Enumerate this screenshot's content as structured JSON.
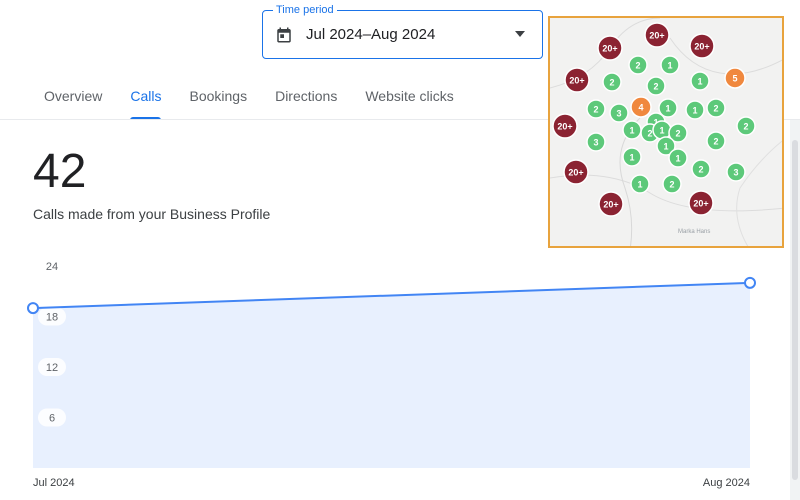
{
  "time_period": {
    "legend": "Time period",
    "value": "Jul 2024–Aug 2024",
    "icon": "calendar-icon",
    "dropdown_icon": "arrow-drop-down-icon"
  },
  "tabs": [
    {
      "label": "Overview",
      "active": false
    },
    {
      "label": "Calls",
      "active": true
    },
    {
      "label": "Bookings",
      "active": false
    },
    {
      "label": "Directions",
      "active": false
    },
    {
      "label": "Website clicks",
      "active": false
    }
  ],
  "kpi": {
    "value": "42",
    "label": "Calls made from your Business Profile"
  },
  "chart_data": {
    "type": "area",
    "categories": [
      "Jul 2024",
      "Aug 2024"
    ],
    "values": [
      19,
      22
    ],
    "ylim": [
      0,
      24
    ],
    "y_ticks": [
      6,
      12,
      18,
      24
    ],
    "grid": false,
    "colors": {
      "line": "#4285f4",
      "fill": "#e8f0fe",
      "marker_fill": "#ffffff"
    }
  },
  "map": {
    "credit": "Marka Hans",
    "colors": {
      "cluster_20": "#8b2332",
      "cluster_mid": "#f0883e",
      "cluster_low": "#5dc97a",
      "border": "#e8a33d"
    },
    "clusters": [
      {
        "label": "20+",
        "size": "large"
      },
      {
        "label": "20+",
        "size": "large"
      },
      {
        "label": "20+",
        "size": "large"
      },
      {
        "label": "20+",
        "size": "large"
      },
      {
        "label": "5",
        "size": "mid"
      },
      {
        "label": "2",
        "size": "low"
      },
      {
        "label": "1",
        "size": "low"
      },
      {
        "label": "2",
        "size": "low"
      },
      {
        "label": "2",
        "size": "low"
      },
      {
        "label": "1",
        "size": "low"
      },
      {
        "label": "2",
        "size": "low"
      },
      {
        "label": "3",
        "size": "low"
      },
      {
        "label": "4",
        "size": "mid"
      },
      {
        "label": "1",
        "size": "low"
      },
      {
        "label": "1",
        "size": "low"
      },
      {
        "label": "2",
        "size": "low"
      },
      {
        "label": "20+",
        "size": "large"
      },
      {
        "label": "3",
        "size": "low"
      },
      {
        "label": "2",
        "size": "low"
      },
      {
        "label": "1",
        "size": "low"
      },
      {
        "label": "2",
        "size": "low"
      },
      {
        "label": "1",
        "size": "low"
      },
      {
        "label": "2",
        "size": "low"
      },
      {
        "label": "1",
        "size": "low"
      },
      {
        "label": "1",
        "size": "low"
      },
      {
        "label": "2",
        "size": "low"
      },
      {
        "label": "20+",
        "size": "large"
      },
      {
        "label": "1",
        "size": "low"
      },
      {
        "label": "2",
        "size": "low"
      },
      {
        "label": "3",
        "size": "low"
      },
      {
        "label": "1",
        "size": "low"
      },
      {
        "label": "1",
        "size": "low"
      },
      {
        "label": "2",
        "size": "low"
      },
      {
        "label": "20+",
        "size": "large"
      },
      {
        "label": "20+",
        "size": "large"
      }
    ]
  }
}
